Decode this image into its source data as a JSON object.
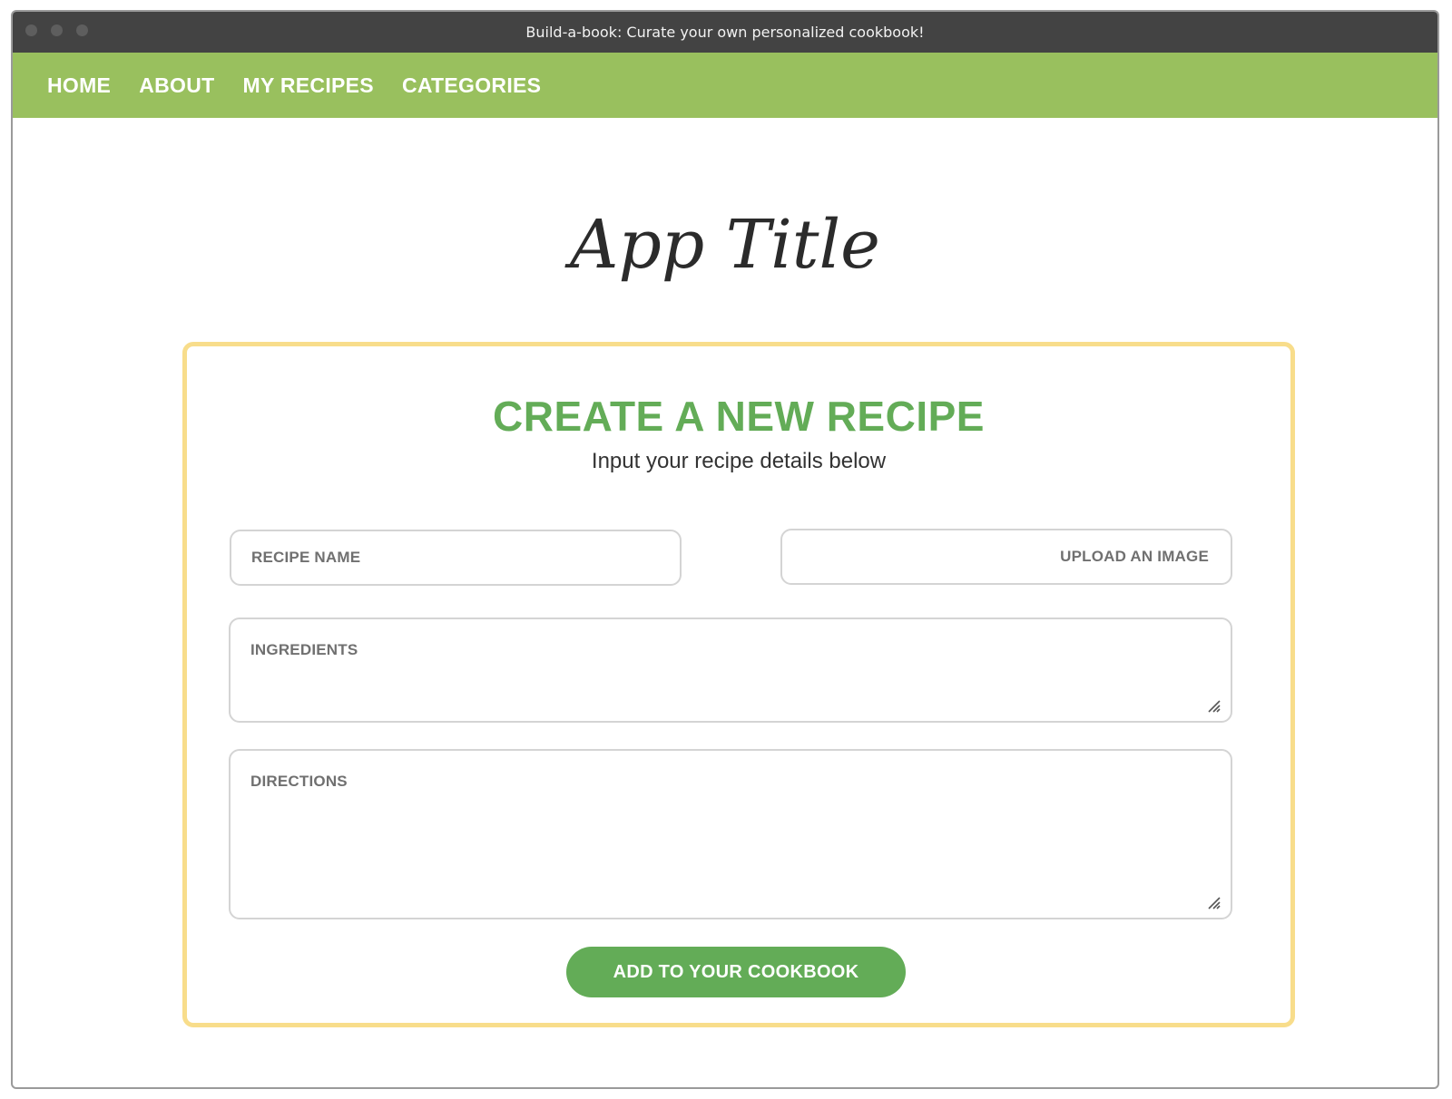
{
  "window": {
    "title": "Build-a-book: Curate your own personalized cookbook!"
  },
  "nav": {
    "items": [
      {
        "label": "HOME"
      },
      {
        "label": "ABOUT"
      },
      {
        "label": "MY RECIPES"
      },
      {
        "label": "CATEGORIES"
      }
    ]
  },
  "app": {
    "title": "App Title"
  },
  "form": {
    "heading": "CREATE A NEW RECIPE",
    "subheading": "Input your recipe details below",
    "recipe_name_label": "RECIPE NAME",
    "upload_label": "UPLOAD AN IMAGE",
    "ingredients_label": "INGREDIENTS",
    "directions_label": "DIRECTIONS",
    "submit_label": "ADD TO YOUR COOKBOOK"
  },
  "colors": {
    "nav_background": "#99c05e",
    "accent_green": "#63ac57",
    "card_border": "#f8dd8b",
    "titlebar": "#434343"
  },
  "icons": {
    "resize": "resize-handle-icon"
  }
}
